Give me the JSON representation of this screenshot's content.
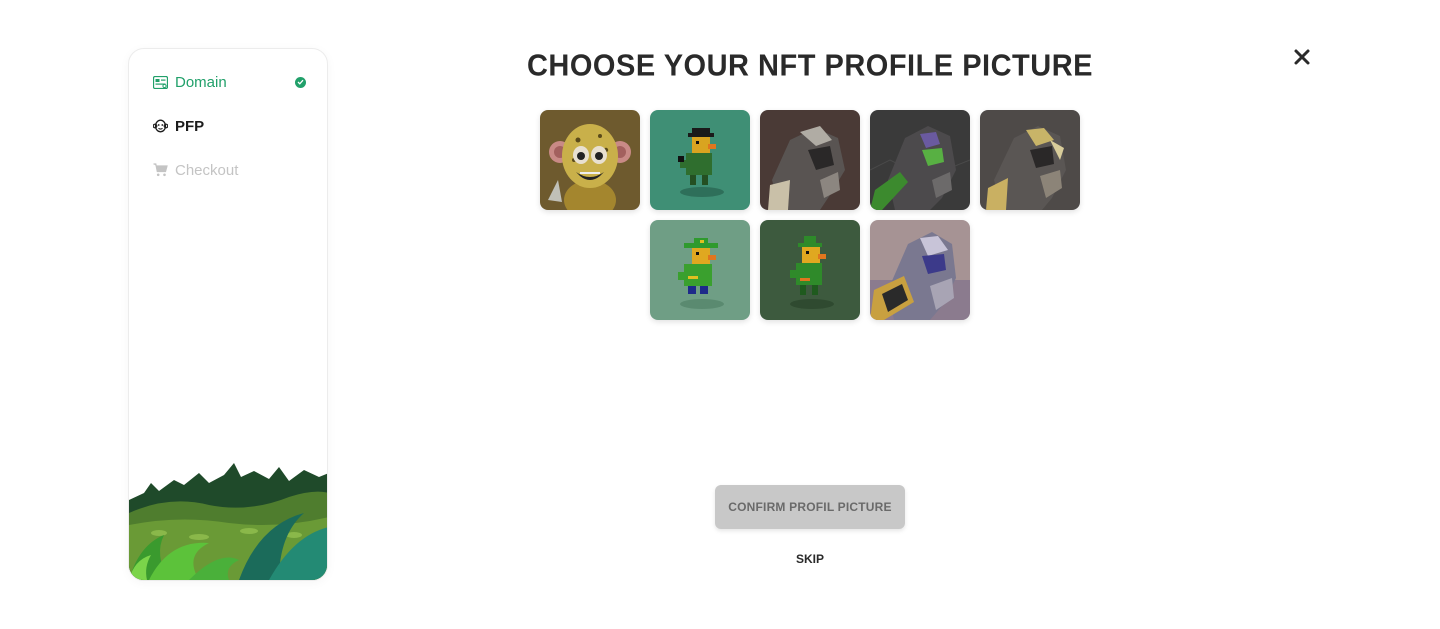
{
  "sidebar": {
    "steps": [
      {
        "label": "Domain",
        "state": "completed",
        "icon": "domain-card-icon"
      },
      {
        "label": "PFP",
        "state": "active",
        "icon": "monkey-face-icon"
      },
      {
        "label": "Checkout",
        "state": "disabled",
        "icon": "cart-icon"
      }
    ]
  },
  "main": {
    "title": "CHOOSE YOUR NFT PROFILE PICTURE",
    "confirm_label": "CONFIRM PROFIL PICTURE",
    "skip_label": "SKIP"
  },
  "nfts": [
    {
      "kind": "monkey",
      "bg": "#6e5a2e"
    },
    {
      "kind": "duck-black-hat",
      "bg": "#3f8f75"
    },
    {
      "kind": "robot-dark",
      "bg": "#4a3a36"
    },
    {
      "kind": "robot-green",
      "bg": "#3a3a3a"
    },
    {
      "kind": "robot-gold",
      "bg": "#4e4a48"
    },
    {
      "kind": "duck-green-hat",
      "bg": "#6f9e85"
    },
    {
      "kind": "duck-green-hat-dark",
      "bg": "#3d5a3e"
    },
    {
      "kind": "robot-purple",
      "bg": "#a69394"
    }
  ],
  "colors": {
    "accent": "#21a06a",
    "text": "#2a2a2a",
    "disabled": "#c4c4c4",
    "button_bg": "#c8c8c8"
  }
}
